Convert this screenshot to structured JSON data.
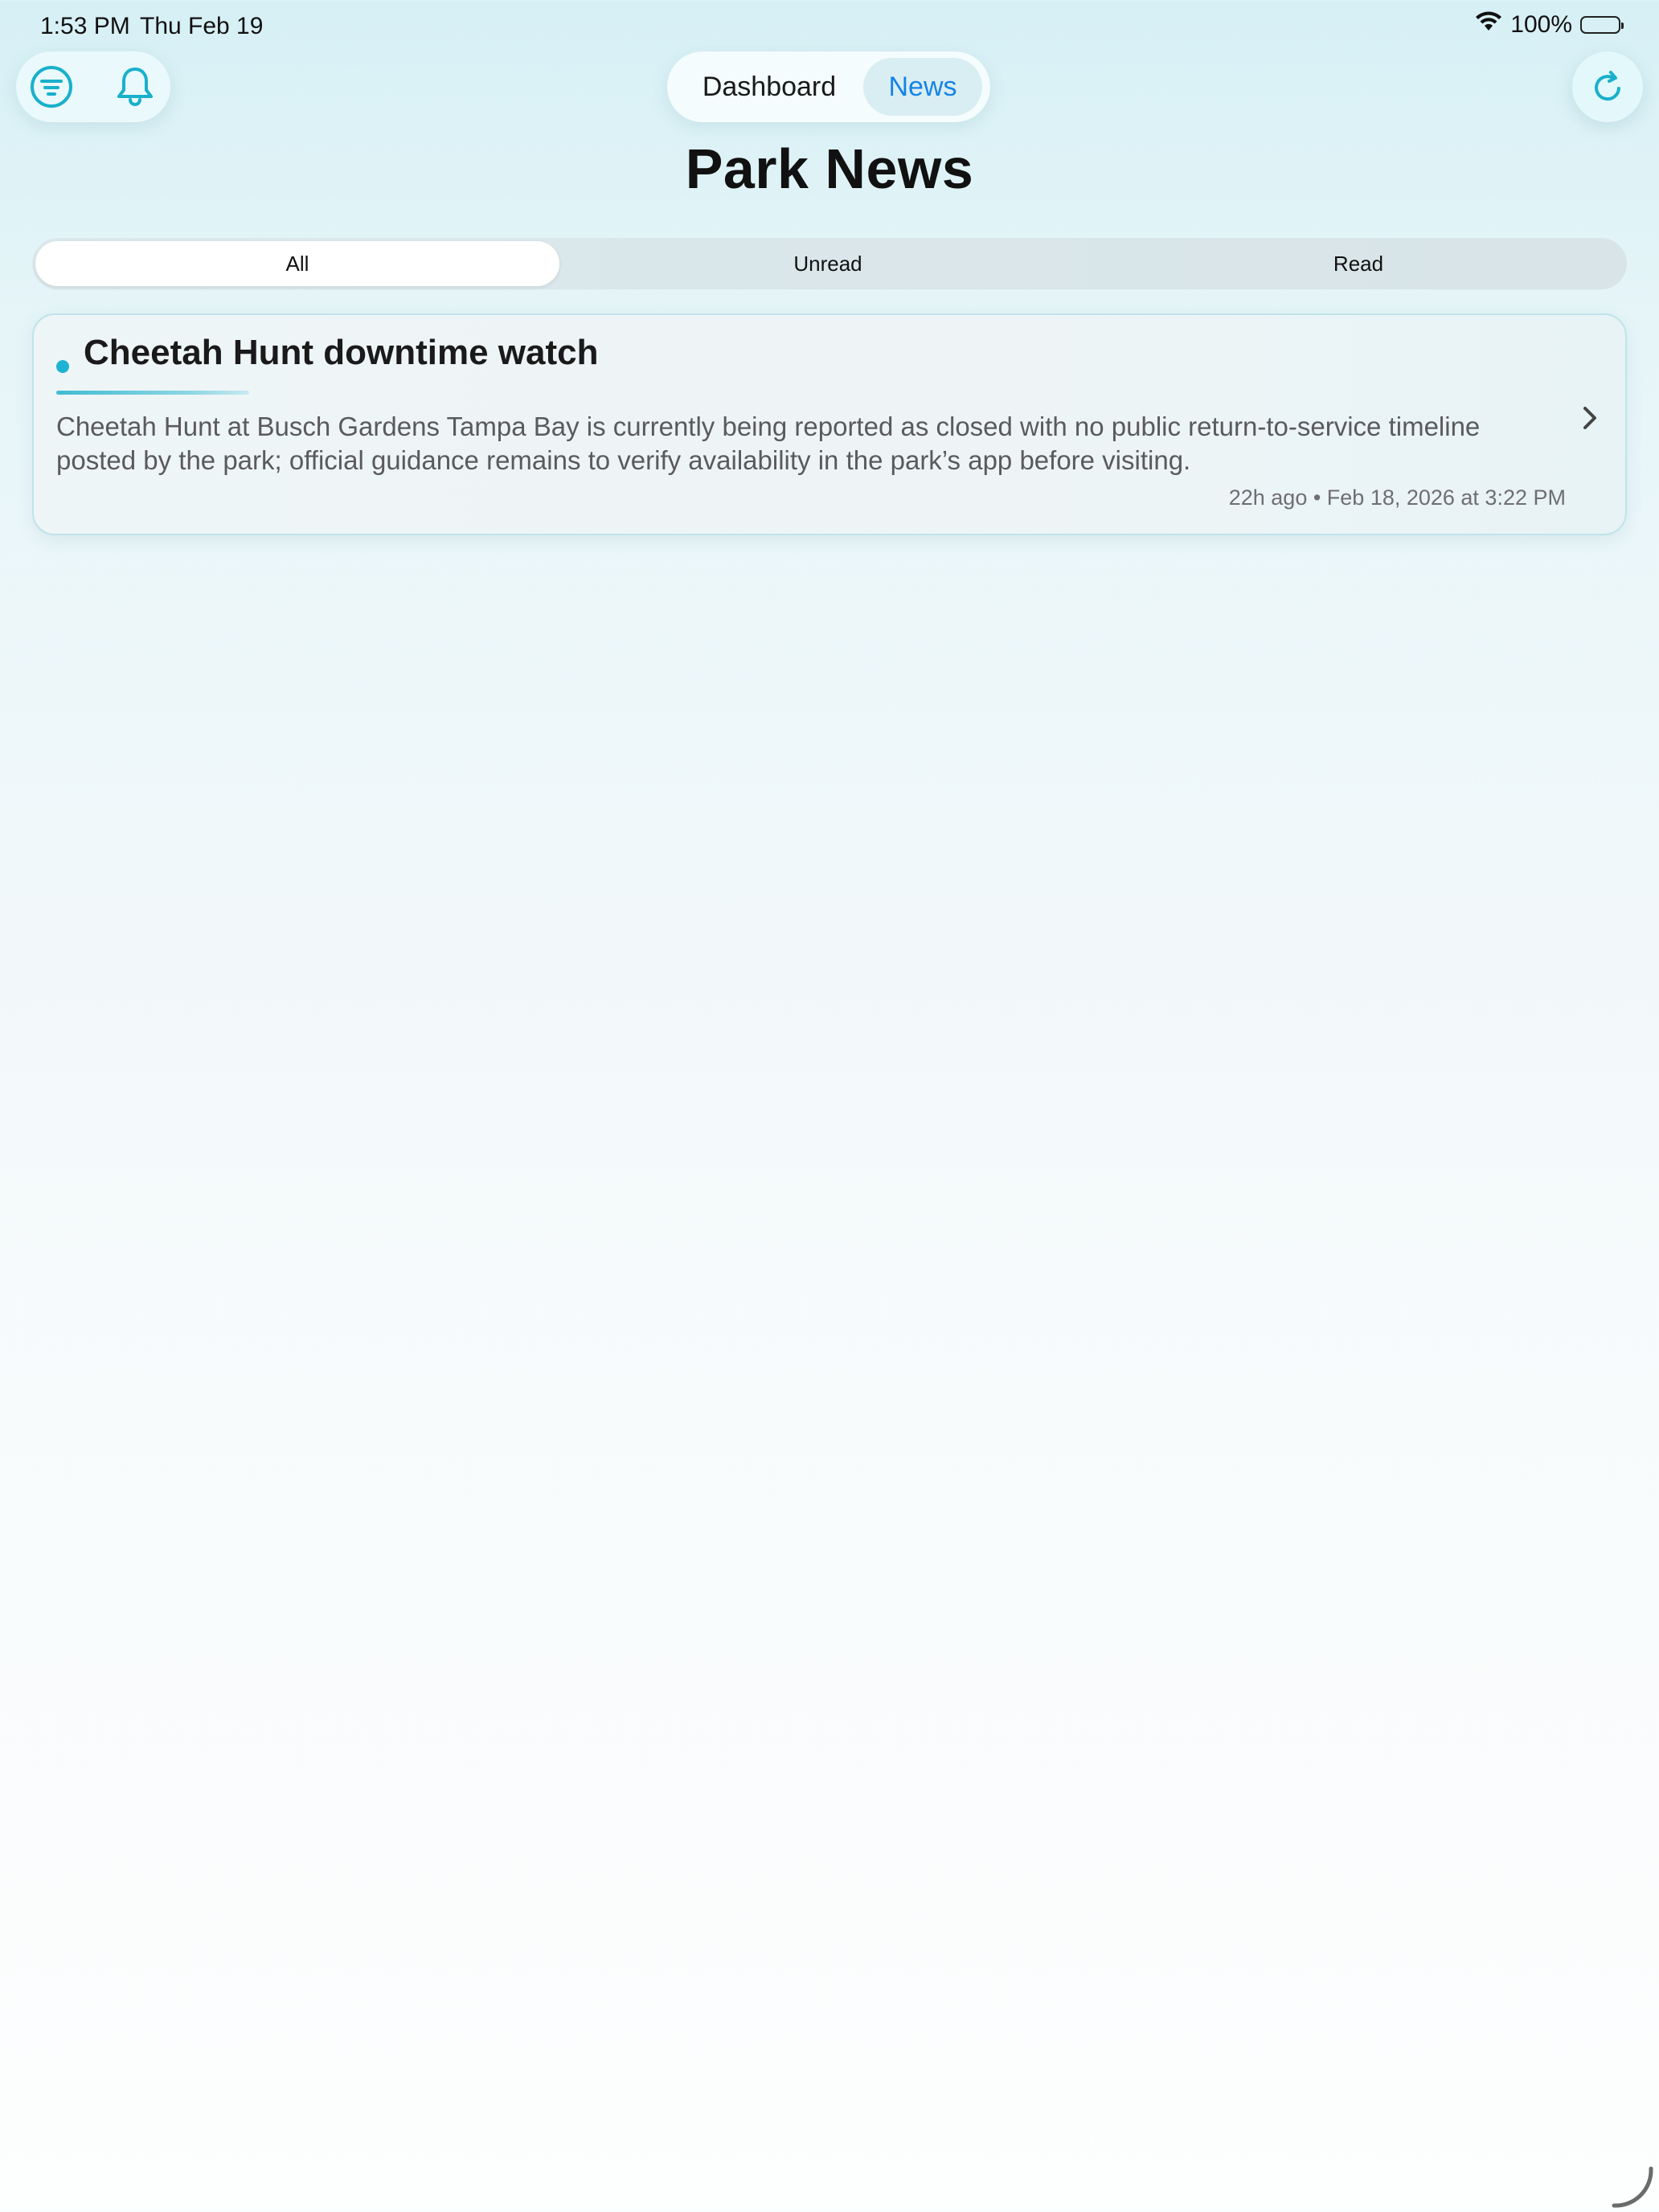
{
  "status_bar": {
    "time": "1:53 PM",
    "date": "Thu Feb 19",
    "battery": "100%"
  },
  "toolbar": {
    "filter_icon": "filter-icon",
    "bell_icon": "bell-icon",
    "refresh_icon": "refresh-icon"
  },
  "nav": {
    "dashboard_label": "Dashboard",
    "news_label": "News",
    "selected": "News"
  },
  "page": {
    "title": "Park News"
  },
  "filters": {
    "all": "All",
    "unread": "Unread",
    "read": "Read",
    "selected": "All"
  },
  "news": {
    "items": [
      {
        "title": "Cheetah Hunt downtime watch",
        "body": "Cheetah Hunt at Busch Gardens Tampa Bay is currently being reported as closed with no public return-to-service timeline posted by the park; official guidance remains to verify availability in the park’s app before visiting.",
        "meta": "22h ago • Feb 18, 2026 at 3:22 PM",
        "unread": true
      }
    ]
  },
  "colors": {
    "accent": "#1eb3d2",
    "selected_nav_text": "#1583e6",
    "title_text": "#111111"
  }
}
